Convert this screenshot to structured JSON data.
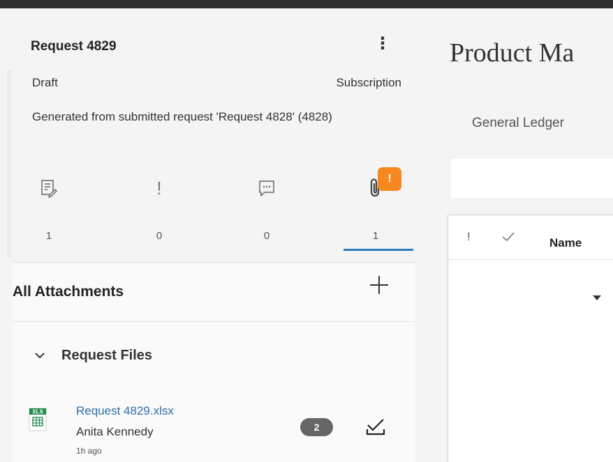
{
  "request": {
    "title": "Request 4829",
    "status": "Draft",
    "type": "Subscription",
    "description": "Generated from submitted request 'Request 4828' (4828)"
  },
  "tabs": [
    {
      "icon": "form-edit-icon",
      "count": "1"
    },
    {
      "icon": "exclamation-icon",
      "label": "!",
      "count": "0"
    },
    {
      "icon": "comment-icon",
      "count": "0"
    },
    {
      "icon": "paperclip-icon",
      "count": "1",
      "badge": "!"
    }
  ],
  "attachments": {
    "title": "All Attachments",
    "group_label": "Request Files",
    "file": {
      "name": "Request 4829.xlsx",
      "user": "Anita Kennedy",
      "time": "1h ago",
      "versions": "2",
      "icon_label": "XLS"
    }
  },
  "main": {
    "title": "Product Ma",
    "tab_label": "General Ledger",
    "table": {
      "col_issue": "!",
      "col_name": "Name"
    }
  },
  "colors": {
    "accent": "#2b7bbd",
    "badge": "#f5881f",
    "link": "#2a6fa8"
  }
}
